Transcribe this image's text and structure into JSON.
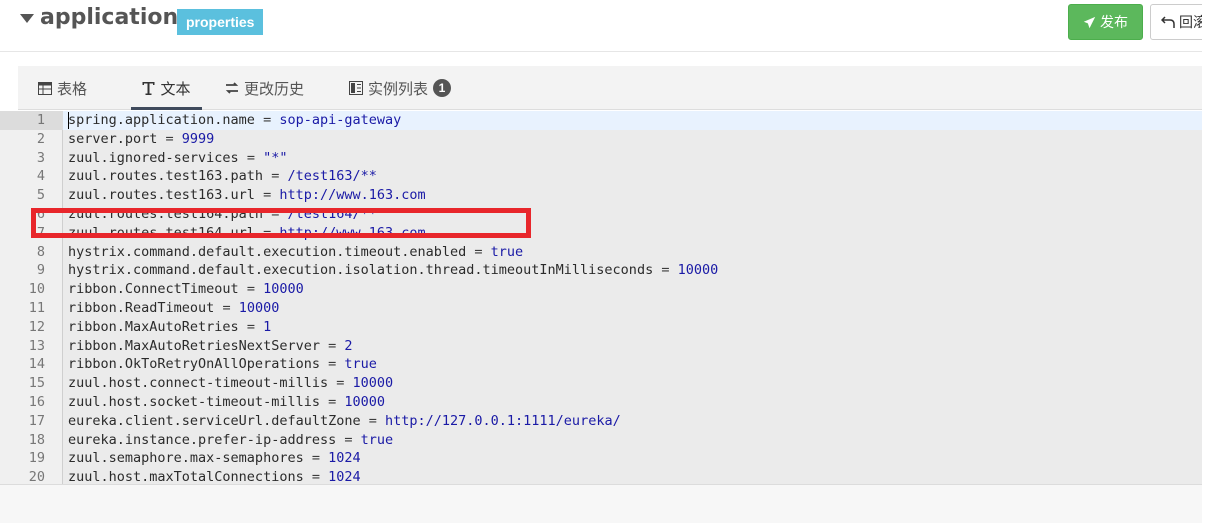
{
  "header": {
    "title": "application",
    "format_badge": "properties",
    "publish_label": "发布",
    "rollback_label": "回滚"
  },
  "tabs": [
    {
      "label": "表格",
      "icon": "table-icon"
    },
    {
      "label": "文本",
      "icon": "text-icon",
      "active": true
    },
    {
      "label": "更改历史",
      "icon": "exchange-icon"
    },
    {
      "label": "实例列表",
      "icon": "instances-icon",
      "badge": "1"
    }
  ],
  "editor": {
    "active_line": 1,
    "lines": [
      {
        "num": "1",
        "key": "spring.application.name",
        "op": " = ",
        "value": "sop-api-gateway"
      },
      {
        "num": "2",
        "key": "server.port",
        "op": " = ",
        "value": "9999"
      },
      {
        "num": "3",
        "key": "zuul.ignored-services",
        "op": " = ",
        "value": "\"*\""
      },
      {
        "num": "4",
        "key": "zuul.routes.test163.path",
        "op": " = ",
        "value": "/test163/**"
      },
      {
        "num": "5",
        "key": "zuul.routes.test163.url",
        "op": " = ",
        "value": "http://www.163.com"
      },
      {
        "num": "6",
        "key": "zuul.routes.test164.path",
        "op": " = ",
        "value": "/test164/**"
      },
      {
        "num": "7",
        "key": "zuul.routes.test164.url",
        "op": " = ",
        "value": "http://www.163.com"
      },
      {
        "num": "8",
        "key": "hystrix.command.default.execution.timeout.enabled",
        "op": " = ",
        "value": "true"
      },
      {
        "num": "9",
        "key": "hystrix.command.default.execution.isolation.thread.timeoutInMilliseconds",
        "op": " = ",
        "value": "10000"
      },
      {
        "num": "10",
        "key": "ribbon.ConnectTimeout",
        "op": " = ",
        "value": "10000"
      },
      {
        "num": "11",
        "key": "ribbon.ReadTimeout",
        "op": " = ",
        "value": "10000"
      },
      {
        "num": "12",
        "key": "ribbon.MaxAutoRetries",
        "op": " = ",
        "value": "1"
      },
      {
        "num": "13",
        "key": "ribbon.MaxAutoRetriesNextServer",
        "op": " = ",
        "value": "2"
      },
      {
        "num": "14",
        "key": "ribbon.OkToRetryOnAllOperations",
        "op": " = ",
        "value": "true"
      },
      {
        "num": "15",
        "key": "zuul.host.connect-timeout-millis",
        "op": " = ",
        "value": "10000"
      },
      {
        "num": "16",
        "key": "zuul.host.socket-timeout-millis",
        "op": " = ",
        "value": "10000"
      },
      {
        "num": "17",
        "key": "eureka.client.serviceUrl.defaultZone",
        "op": " = ",
        "value": "http://127.0.0.1:1111/eureka/"
      },
      {
        "num": "18",
        "key": "eureka.instance.prefer-ip-address",
        "op": " = ",
        "value": "true"
      },
      {
        "num": "19",
        "key": "zuul.semaphore.max-semaphores",
        "op": " = ",
        "value": "1024"
      },
      {
        "num": "20",
        "key": "zuul.host.maxTotalConnections",
        "op": " = ",
        "value": "1024"
      }
    ]
  },
  "colors": {
    "publish": "#5cb85c",
    "badge": "#5bc0de",
    "highlight": "#e8262b",
    "value_text": "#1a1aa6"
  }
}
